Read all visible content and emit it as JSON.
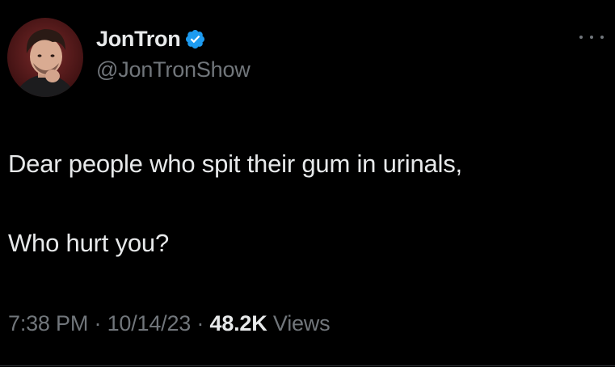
{
  "author": {
    "display_name": "JonTron",
    "handle": "@JonTronShow",
    "verified": true
  },
  "tweet": {
    "line1": "Dear people who spit their gum in urinals,",
    "line2": "Who hurt you?"
  },
  "meta": {
    "time": "7:38 PM",
    "separator": "·",
    "date": "10/14/23",
    "views_count": "48.2K",
    "views_label": "Views"
  },
  "icons": {
    "verified": "verified-badge-icon",
    "more": "more-options-icon"
  },
  "colors": {
    "background": "#000000",
    "primary_text": "#e7e9ea",
    "secondary_text": "#71767b",
    "verified_blue": "#1d9bf0"
  }
}
